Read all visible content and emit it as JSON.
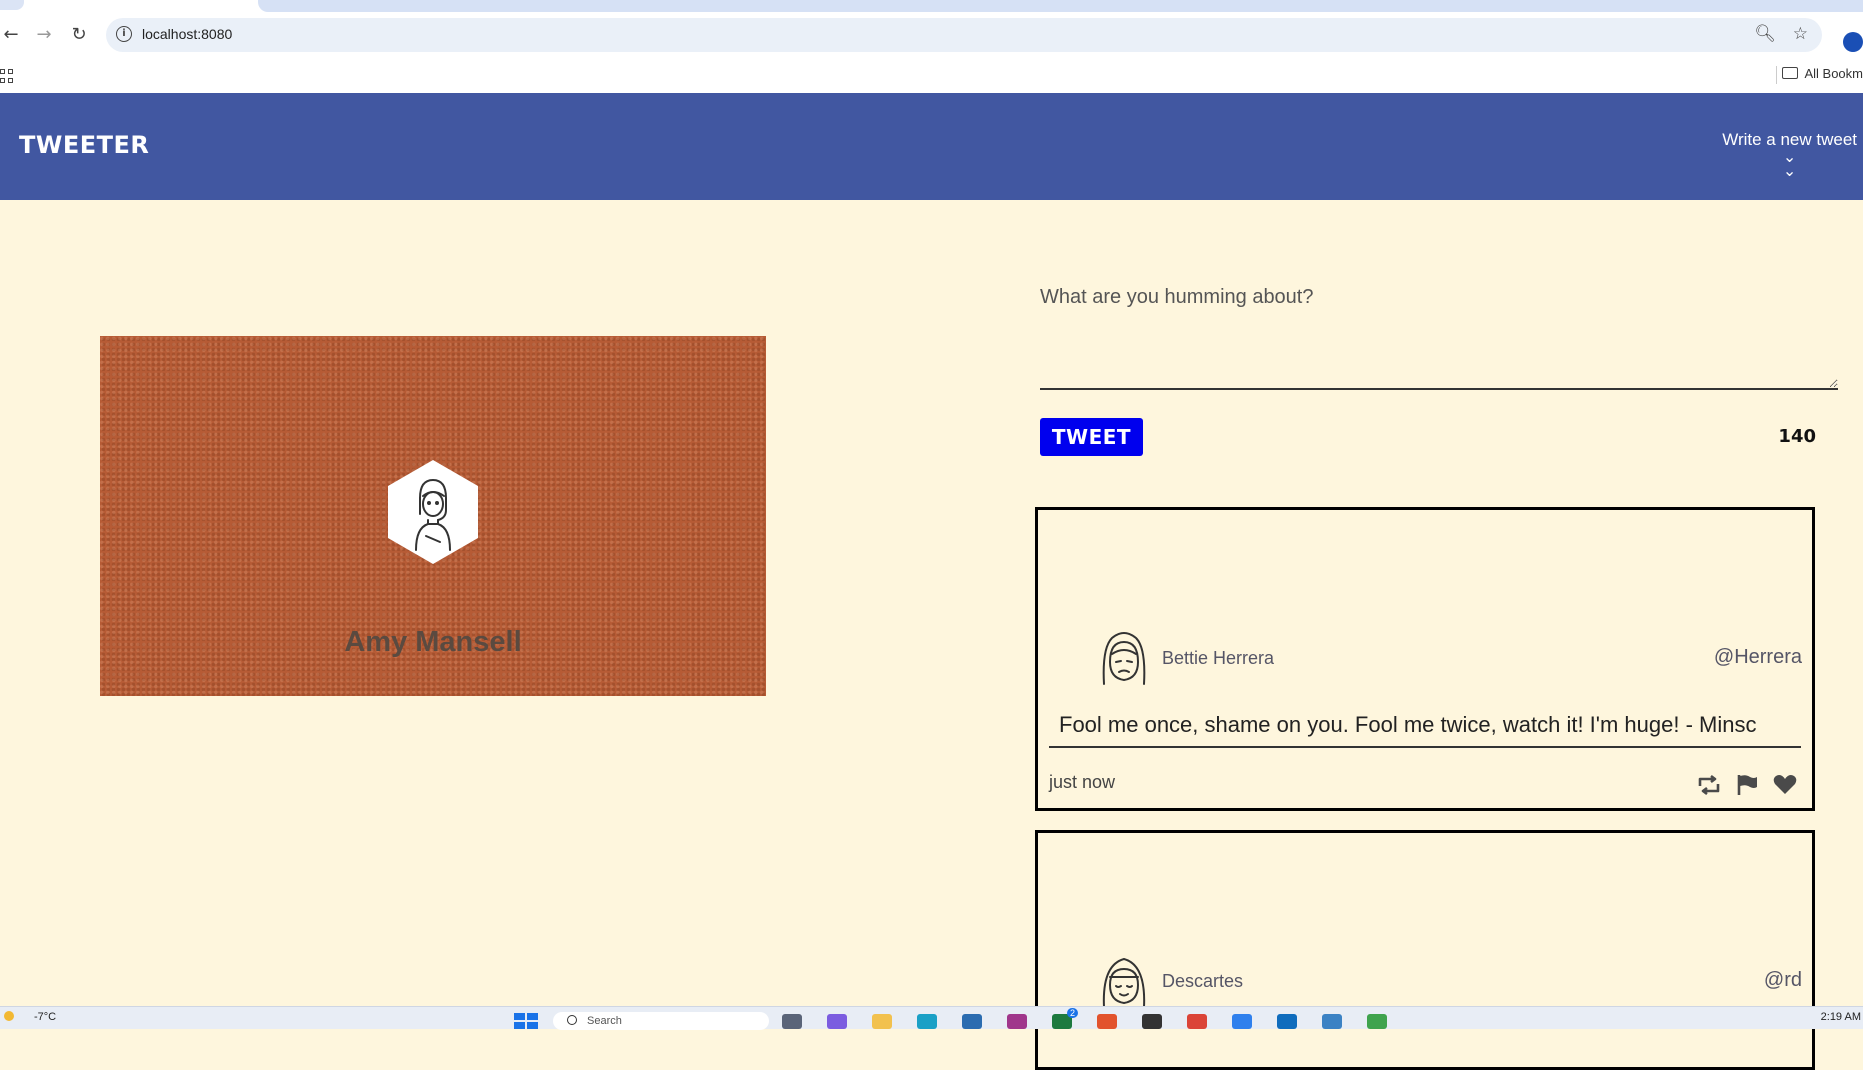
{
  "browser": {
    "url": "localhost:8080",
    "bookmarks_label": "All Bookm"
  },
  "header": {
    "title": "TWEETER",
    "write_new": "Write a new tweet"
  },
  "profile": {
    "name": "Amy Mansell"
  },
  "composer": {
    "placeholder": "What are you humming about?",
    "button_label": "TWEET",
    "char_count": "140"
  },
  "tweets": [
    {
      "name": "Bettie Herrera",
      "handle": "@Herrera",
      "text": "Fool me once, shame on you. Fool me twice, watch it! I'm huge! - Minsc",
      "time": "just now",
      "actions": [
        "retweet-icon",
        "flag-icon",
        "heart-icon"
      ]
    },
    {
      "name": "Descartes",
      "handle": "@rd"
    }
  ],
  "taskbar": {
    "weather": "-7°C",
    "search_placeholder": "Search",
    "badge_count": "2",
    "time": "2:19 AM"
  },
  "colors": {
    "header_bg": "#4157a1",
    "page_bg": "#fef6dd",
    "tweet_button": "#0000ee",
    "profile_card": "#b65b35"
  }
}
